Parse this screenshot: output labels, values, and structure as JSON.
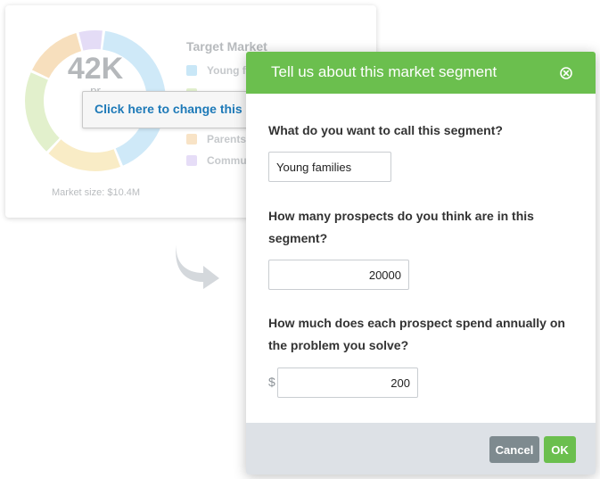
{
  "background_card": {
    "donut_value": "42K",
    "donut_subtitle": "pr",
    "market_size": "Market size: $10.4M",
    "legend_title": "Target Market",
    "legend_items": [
      {
        "label": "Young f",
        "color": "#c9e7f7"
      },
      {
        "label": "",
        "color": "#e3f1cf"
      },
      {
        "label": "",
        "color": "#f7e2c3"
      },
      {
        "label": "Parents",
        "color": "#f8e3c6"
      },
      {
        "label": "Commu",
        "color": "#e6ddf7"
      }
    ],
    "donut_segments": [
      {
        "name": "young-families",
        "fraction": 0.42,
        "color": "#cfe9f8"
      },
      {
        "name": "segment-b",
        "fraction": 0.18,
        "color": "#f9ecc6"
      },
      {
        "name": "segment-c",
        "fraction": 0.2,
        "color": "#e2f0cc"
      },
      {
        "name": "parents",
        "fraction": 0.14,
        "color": "#f7dfbd"
      },
      {
        "name": "community",
        "fraction": 0.06,
        "color": "#e4dcf6"
      }
    ],
    "tooltip_text": "Click here to change this"
  },
  "modal": {
    "title": "Tell us about this market segment",
    "accent_color": "#6bbf4e",
    "q1_label": "What do you want to call this segment?",
    "q1_value": "Young families",
    "q2_label": "How many prospects do you think are in this segment?",
    "q2_value": "20000",
    "q3_label": "How much does each prospect spend annually on the problem you solve?",
    "q3_currency": "$",
    "q3_value": "200",
    "cancel_label": "Cancel",
    "ok_label": "OK"
  }
}
